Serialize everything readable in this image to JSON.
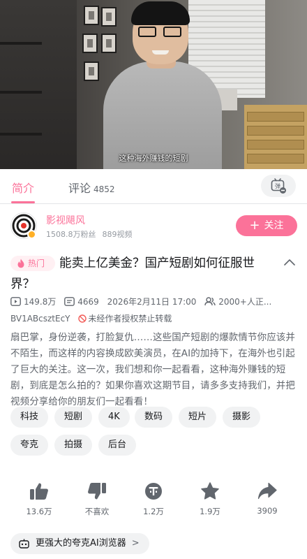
{
  "video": {
    "subtitle": "这种海外赚钱的短剧"
  },
  "tabs": {
    "intro_label": "简介",
    "comment_label": "评论",
    "comment_count": "4852",
    "danmaku_toggle_icon": "danmaku-off-icon"
  },
  "uploader": {
    "name": "影视飓风",
    "fans": "1508.8万粉丝",
    "videos": "889视频",
    "follow_label": "关注"
  },
  "video_info": {
    "hot_label": "热门",
    "title": "能卖上亿美金？国产短剧如何征服世界？",
    "views": "149.8万",
    "danmaku": "4669",
    "date": "2026年2月11日 17:00",
    "watching": "2000+人正...",
    "bvid": "BV1ABcsztEcY",
    "copyright": "未经作者授权禁止转载",
    "description": "扇巴掌，身份逆袭，打脸复仇……这些国产短剧的爆款情节你应该并不陌生，而这样的内容换成欧美演员，在AI的加持下，在海外也引起了巨大的关注。这一次，我们想和你一起看看，这种海外赚钱的短剧，到底是怎么拍的？如果你喜欢这期节目，请多多支持我们，并把视频分享给你的朋友们一起看看！"
  },
  "tags": [
    "科技",
    "短剧",
    "4K",
    "数码",
    "短片",
    "摄影",
    "夸克",
    "拍摄",
    "后台"
  ],
  "actions": {
    "like": "13.6万",
    "dislike": "不喜欢",
    "coin": "1.2万",
    "favorite": "1.9万",
    "share": "3909"
  },
  "promo": {
    "ai_browser": "更强大的夸克AI浏览器"
  },
  "colors": {
    "accent": "#fb7299",
    "text_primary": "#18191c",
    "text_secondary": "#61666d",
    "pill_bg": "#f1f2f3"
  }
}
